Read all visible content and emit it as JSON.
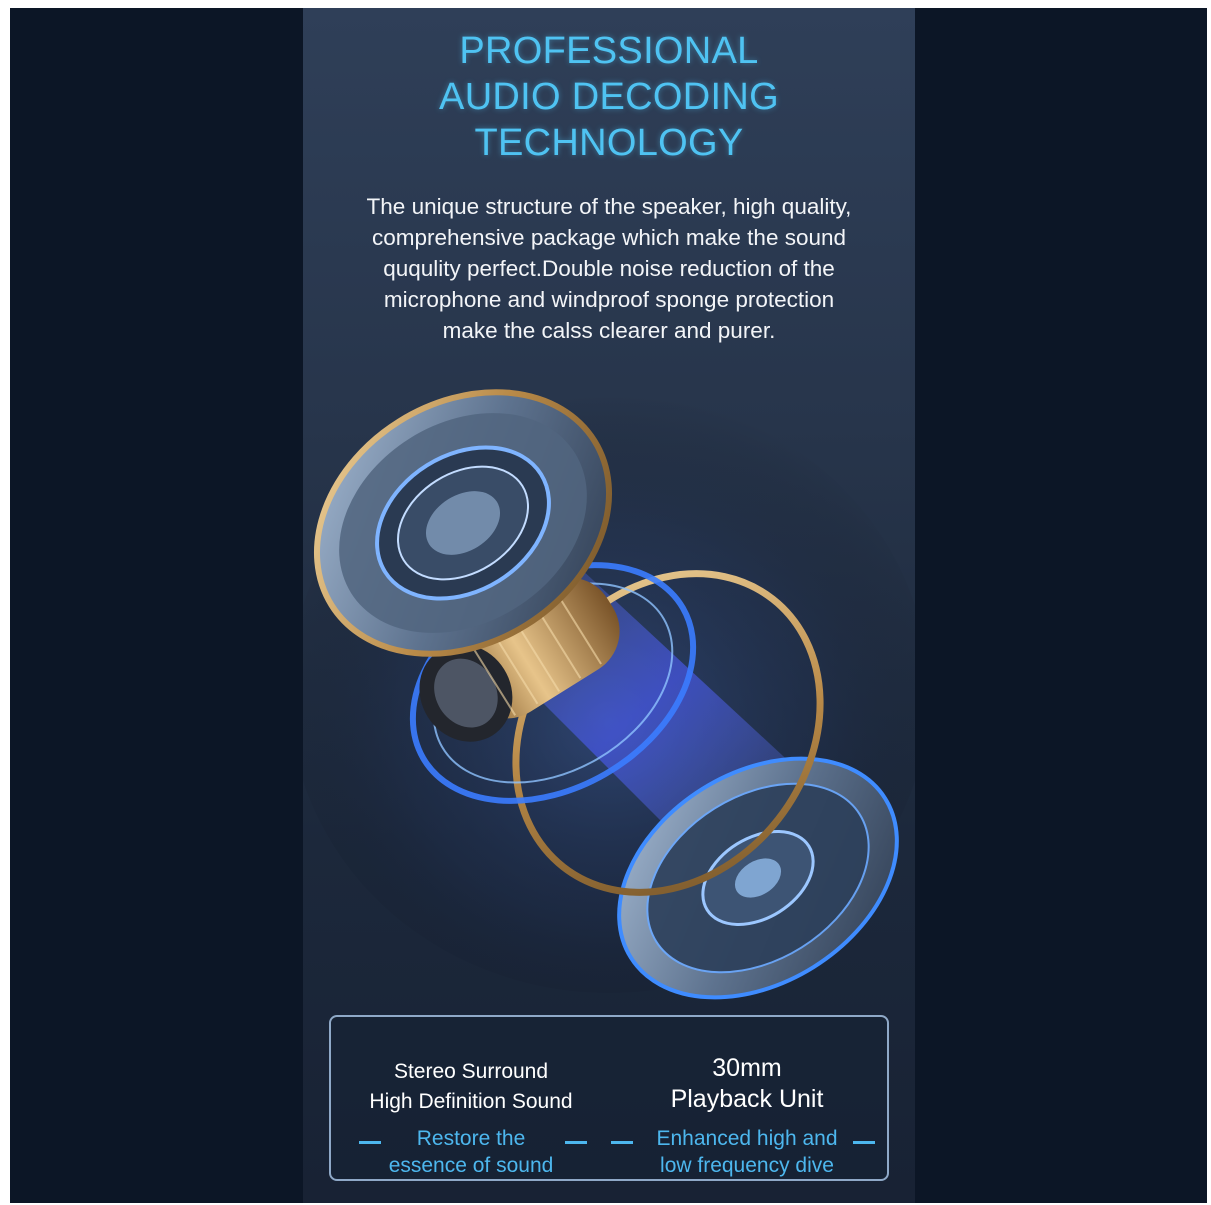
{
  "title": {
    "line1": "PROFESSIONAL",
    "line2": "AUDIO DECODING",
    "line3": "TECHNOLOGY"
  },
  "description": {
    "line1": "The unique structure of the speaker, high quality,",
    "line2": "comprehensive package which make the sound",
    "line3": "ququlity perfect.Double noise reduction of the",
    "line4": "microphone and windproof sponge protection",
    "line5": "make the calss clearer and purer."
  },
  "features": [
    {
      "heading_line1": "Stereo Surround",
      "heading_line2": "High Definition Sound",
      "sub_line1": "Restore the",
      "sub_line2": "essence of sound"
    },
    {
      "heading_line1": "30mm",
      "heading_line2": "Playback Unit",
      "sub_line1": "Enhanced high and",
      "sub_line2": "low frequency dive"
    }
  ],
  "colors": {
    "background": "#0c1626",
    "panel": "#27354b",
    "accent_blue": "#4fc3f2",
    "glow_blue": "#2f6dff",
    "gold": "#c9a15f",
    "text": "#f3f5f8"
  },
  "icons": {
    "illustration": "exploded-speaker-driver-icon"
  }
}
